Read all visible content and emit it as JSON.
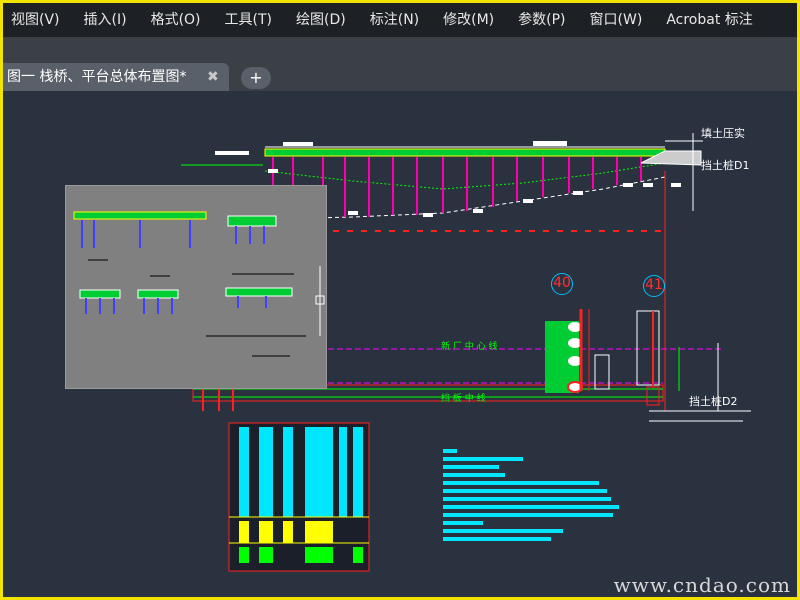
{
  "menu": {
    "items": [
      "视图(V)",
      "插入(I)",
      "格式(O)",
      "工具(T)",
      "绘图(D)",
      "标注(N)",
      "修改(M)",
      "参数(P)",
      "窗口(W)",
      "Acrobat 标注"
    ]
  },
  "tabs": {
    "active_label": "图一 栈桥、平台总体布置图*",
    "close_glyph": "✖",
    "add_glyph": "+"
  },
  "drawing": {
    "label_fill": "填土压实",
    "label_pile_d1": "挡土桩D1",
    "label_pile_d2": "挡土桩D2",
    "label_centerline": "新 厂 中 心 线",
    "label_beam": "挡 板 中 线",
    "axis_40": "40",
    "axis_41": "41"
  },
  "watermark": "www.cndao.com",
  "colors": {
    "frame_border": "#f2e400",
    "background": "#2a3240",
    "accent_red": "#ff2020",
    "accent_green": "#00ff00",
    "accent_cyan": "#00ffff",
    "accent_magenta": "#ff00ff",
    "accent_yellow": "#ffff00"
  }
}
